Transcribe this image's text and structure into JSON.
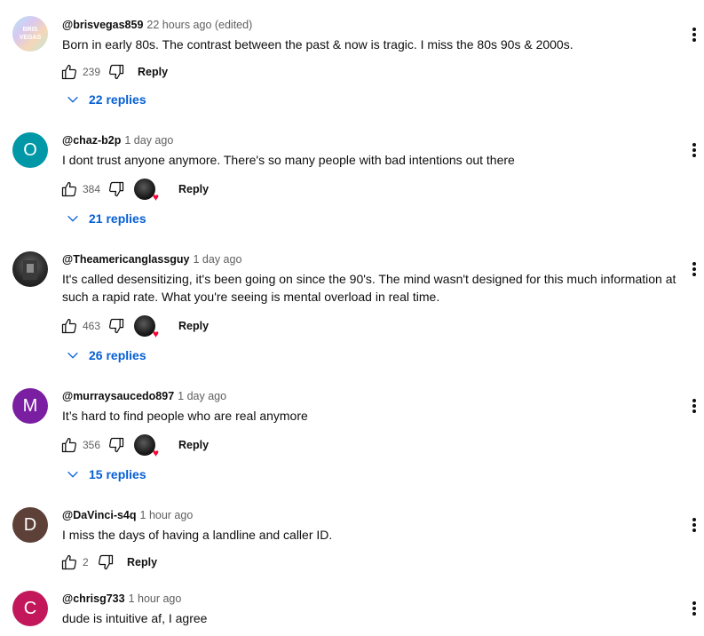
{
  "comments": [
    {
      "handle": "@brisvegas859",
      "time": "22 hours ago (edited)",
      "text": "Born in early 80s. The contrast between the past & now is tragic. I miss the 80s 90s & 2000s.",
      "likes": "239",
      "reply_label": "Reply",
      "replies": "22 replies",
      "avatar_text": "BRIS VEGAS"
    },
    {
      "handle": "@chaz-b2p",
      "time": "1 day ago",
      "text": "I dont trust anyone anymore. There's so many people with bad intentions out there",
      "likes": "384",
      "reply_label": "Reply",
      "replies": "21 replies",
      "avatar_letter": "O",
      "avatar_color": "#0097a7"
    },
    {
      "handle": "@Theamericanglassguy",
      "time": "1 day ago",
      "text": "It's called desensitizing, it's been going on since the 90's. The mind wasn't designed for this much information at such a rapid rate. What you're seeing is mental overload in real time.",
      "likes": "463",
      "reply_label": "Reply",
      "replies": "26 replies"
    },
    {
      "handle": "@murraysaucedo897",
      "time": "1 day ago",
      "text": "It’s hard to find people who are real anymore",
      "likes": "356",
      "reply_label": "Reply",
      "replies": "15 replies",
      "avatar_letter": "M",
      "avatar_color": "#7b1fa2"
    },
    {
      "handle": "@DaVinci-s4q",
      "time": "1 hour ago",
      "text": "I miss the days of having a landline and caller ID.",
      "likes": "2",
      "reply_label": "Reply",
      "avatar_letter": "D",
      "avatar_color": "#5d4037"
    },
    {
      "handle": "@chrisg733",
      "time": "1 hour ago",
      "text": "dude is intuitive af, I agree",
      "avatar_letter": "C",
      "avatar_color": "#c2185b"
    }
  ]
}
